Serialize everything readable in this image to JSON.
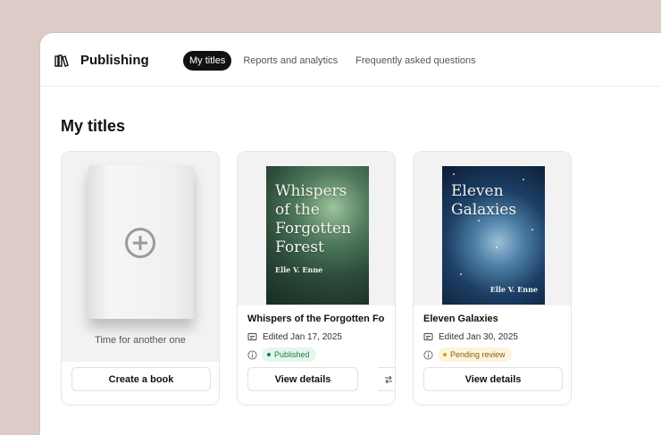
{
  "header": {
    "brand": "Publishing",
    "tabs": [
      {
        "label": "My titles",
        "active": true
      },
      {
        "label": "Reports and analytics",
        "active": false
      },
      {
        "label": "Frequently asked questions",
        "active": false
      }
    ]
  },
  "page": {
    "title": "My titles"
  },
  "new_title_card": {
    "caption": "Time for another one",
    "button": "Create a book",
    "icon": "plus-circle-icon"
  },
  "books": [
    {
      "cover_title": "Whispers of the Forgotten Forest",
      "cover_author": "Elle V. Enne",
      "title": "Whispers of the Forgotten Fo...",
      "edited": "Edited Jan 17, 2025",
      "status": "Published",
      "status_color": "#1a7f4b",
      "status_bg": "#e6f6ec",
      "button": "View details"
    },
    {
      "cover_title": "Eleven Galaxies",
      "cover_author": "Elle V. Enne",
      "title": "Eleven Galaxies",
      "edited": "Edited Jan 30, 2025",
      "status": "Pending review",
      "status_color": "#8a6310",
      "status_bg": "#fdf4dc",
      "button": "View details"
    }
  ]
}
